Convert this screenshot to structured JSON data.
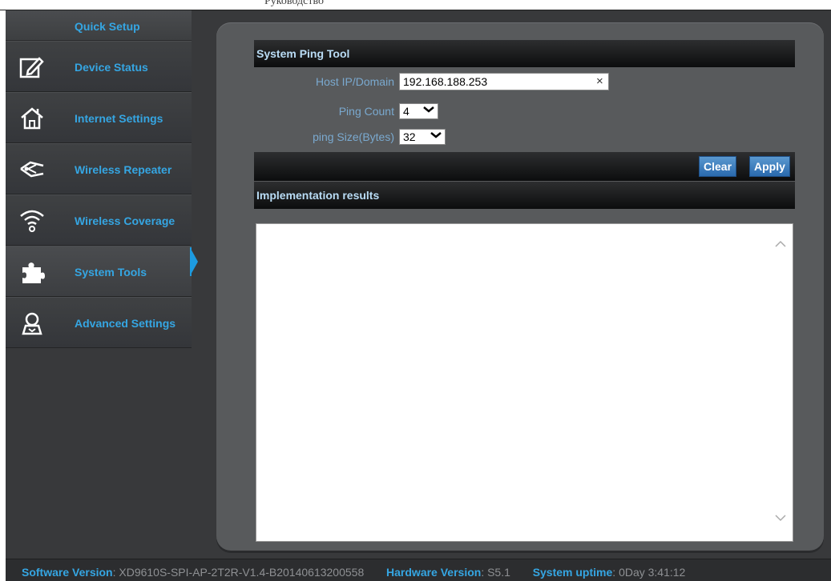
{
  "doc_header": "Руководство",
  "sidebar": {
    "quick_setup": "Quick Setup",
    "items": [
      {
        "label": "Device Status",
        "icon": "edit-icon"
      },
      {
        "label": "Internet Settings",
        "icon": "home-icon"
      },
      {
        "label": "Wireless Repeater",
        "icon": "repeater-icon"
      },
      {
        "label": "Wireless Coverage",
        "icon": "wifi-icon"
      },
      {
        "label": "System Tools",
        "icon": "puzzle-icon",
        "active": true
      },
      {
        "label": "Advanced Settings",
        "icon": "user-icon"
      }
    ]
  },
  "ping_tool": {
    "title": "System Ping Tool",
    "host_label": "Host IP/Domain",
    "host_value": "192.168.188.253",
    "clear_glyph": "×",
    "count_label": "Ping Count",
    "count_value": "4",
    "size_label": "ping Size(Bytes)",
    "size_value": "32",
    "clear_button": "Clear",
    "apply_button": "Apply",
    "results_title": "Implementation results",
    "results_text": ""
  },
  "footer": {
    "software_label": "Software Version",
    "software_value": "XD9610S-SPI-AP-2T2R-V1.4-B20140613200558",
    "hardware_label": "Hardware Version",
    "hardware_value": "S5.1",
    "uptime_label": "System uptime",
    "uptime_value": "0Day 3:41:12"
  },
  "colors": {
    "accent": "#35a6e3",
    "background": "#38393b",
    "panel": "#585a5c",
    "active_indicator": "#1d9be0"
  }
}
